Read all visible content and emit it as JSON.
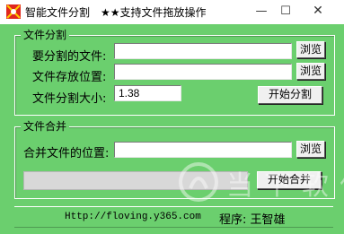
{
  "window": {
    "title": "智能文件分割",
    "subtitle": "★★支持文件拖放操作",
    "controls": {
      "minimize": "—",
      "maximize": "☐",
      "close": "✕"
    }
  },
  "split_group": {
    "title": "文件分割",
    "file_label": "要分割的文件:",
    "file_value": "",
    "file_browse": "浏览",
    "dest_label": "文件存放位置:",
    "dest_value": "",
    "dest_browse": "浏览",
    "size_label": "文件分割大小:",
    "size_value": "1.38",
    "start_button": "开始分割"
  },
  "merge_group": {
    "title": "文件合并",
    "location_label": "合并文件的位置:",
    "location_value": "",
    "location_browse": "浏览",
    "progress": 0,
    "start_button": "开始合并"
  },
  "status": {
    "url": "Http://floving.y365.com",
    "author": "程序: 王智雄"
  },
  "watermark": {
    "text": "当下软件园"
  },
  "colors": {
    "background": "#6bcf6e",
    "titlebar": "#ffffff"
  }
}
